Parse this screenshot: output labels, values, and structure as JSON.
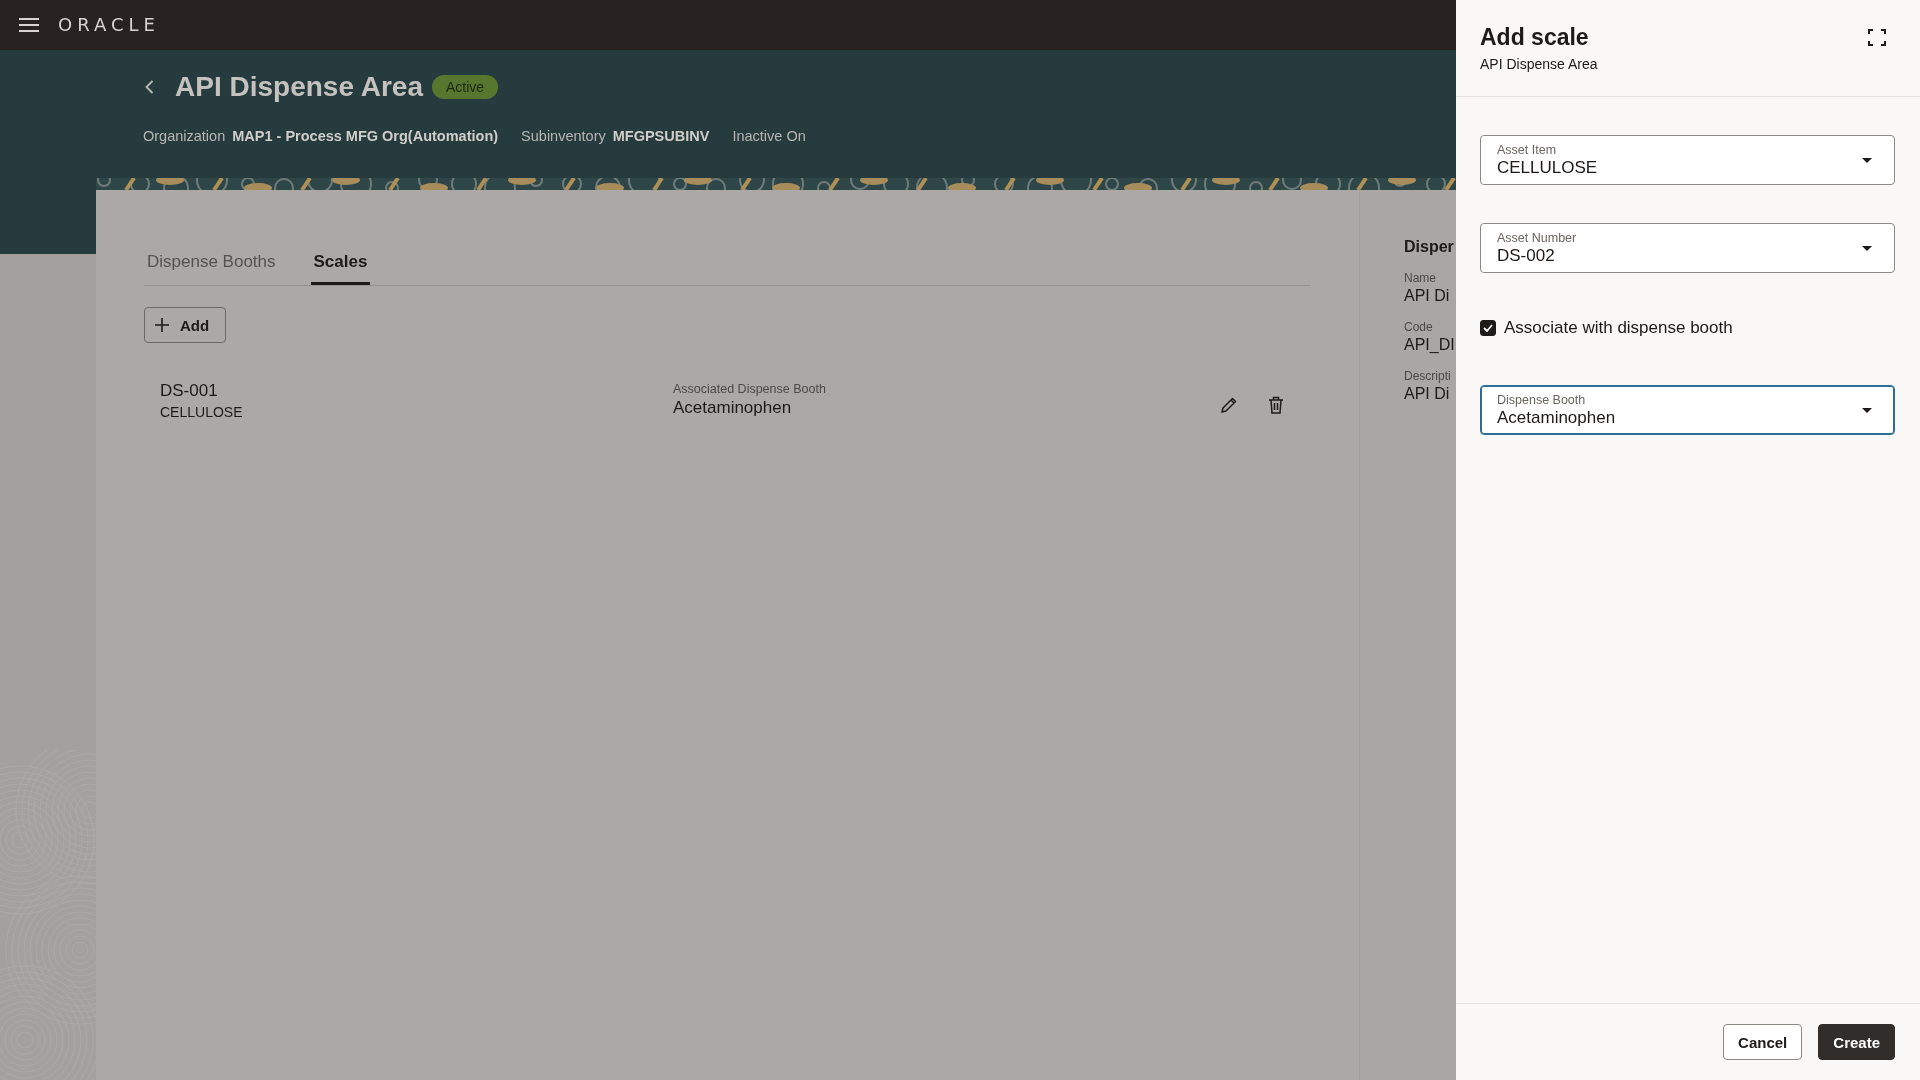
{
  "top_bar": {
    "logo": "ORACLE"
  },
  "header": {
    "title": "API Dispense Area",
    "status": "Active",
    "meta": [
      {
        "label": "Organization",
        "value": "MAP1 - Process MFG Org(Automation)"
      },
      {
        "label": "Subinventory",
        "value": "MFGPSUBINV"
      },
      {
        "label": "Inactive On"
      }
    ]
  },
  "tabs": [
    {
      "label": "Dispense Booths",
      "selected": false
    },
    {
      "label": "Scales",
      "selected": true
    }
  ],
  "add_button": {
    "label": "Add"
  },
  "scales": [
    {
      "number": "DS-001",
      "item": "CELLULOSE",
      "booth_label": "Associated Dispense Booth",
      "booth": "Acetaminophen"
    }
  ],
  "details_panel": {
    "title": "Disper",
    "fields": [
      {
        "label": "Name",
        "value": "API Di"
      },
      {
        "label": "Code",
        "value": "API_DI"
      },
      {
        "label": "Descripti",
        "value": "API Di"
      }
    ]
  },
  "drawer": {
    "title": "Add scale",
    "subtitle": "API Dispense Area",
    "fields": [
      {
        "kind": "select",
        "label": "Asset Item",
        "value": "CELLULOSE",
        "focused": false
      },
      {
        "kind": "select",
        "label": "Asset Number",
        "value": "DS-002",
        "focused": false
      },
      {
        "kind": "checkbox",
        "label": "Associate with dispense booth",
        "checked": true
      },
      {
        "kind": "select",
        "label": "Dispense Booth",
        "value": "Acetaminophen",
        "focused": true
      }
    ],
    "buttons": [
      {
        "label": "Cancel",
        "kind": "secondary"
      },
      {
        "label": "Create",
        "kind": "primary"
      }
    ]
  }
}
